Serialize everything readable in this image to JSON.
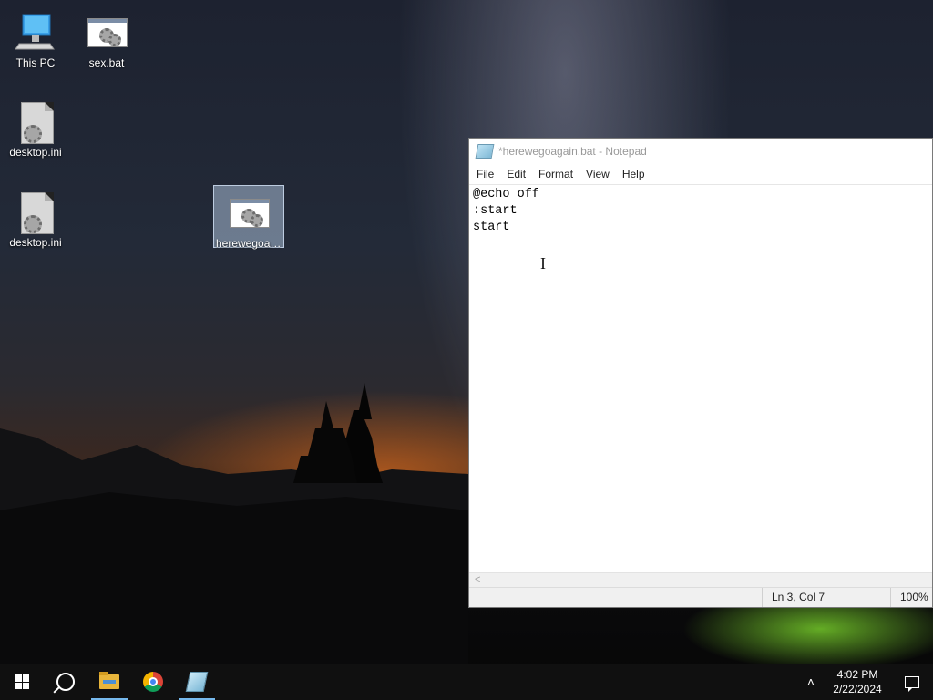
{
  "desktop": {
    "icons": [
      {
        "label": "This PC",
        "icon": "this-pc-icon"
      },
      {
        "label": "sex.bat",
        "icon": "batch-file-icon"
      },
      {
        "label": "desktop.ini",
        "icon": "ini-file-icon"
      },
      {
        "label": "desktop.ini",
        "icon": "ini-file-icon"
      },
      {
        "label": "herewegoag...",
        "icon": "batch-file-icon",
        "selected": true
      }
    ]
  },
  "notepad": {
    "title": "*herewegoagain.bat - Notepad",
    "menu": [
      "File",
      "Edit",
      "Format",
      "View",
      "Help"
    ],
    "content": "@echo off\n:start\nstart",
    "status": {
      "position": "Ln 3, Col 7",
      "zoom": "100%"
    }
  },
  "taskbar": {
    "apps": [
      "start-button",
      "search-button",
      "file-explorer",
      "google-chrome",
      "notepad"
    ],
    "clock": {
      "time": "4:02 PM",
      "date": "2/22/2024"
    }
  },
  "colors": {
    "taskbar_bg": "#101010",
    "taskbar_active_indicator": "#76b9ed",
    "selection": "#aabed7"
  }
}
